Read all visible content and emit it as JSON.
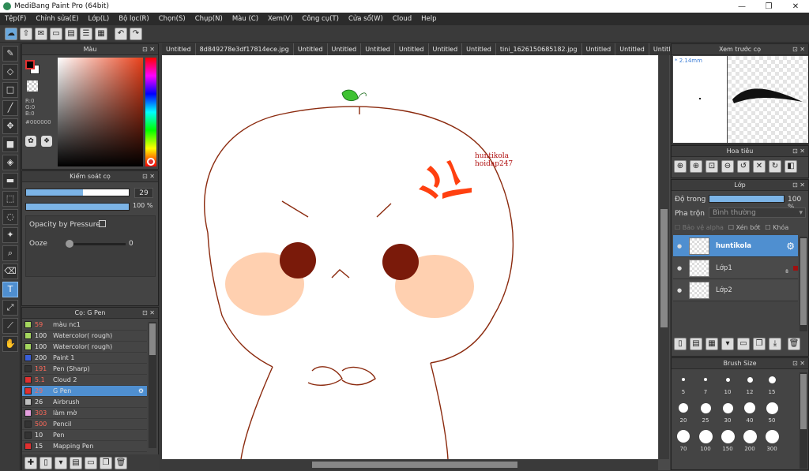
{
  "window": {
    "title": "MediBang Paint Pro (64bit)"
  },
  "menu": [
    "Tệp(F)",
    "Chỉnh sửa(E)",
    "Lớp(L)",
    "Bộ lọc(R)",
    "Chọn(S)",
    "Chụp(N)",
    "Màu (C)",
    "Xem(V)",
    "Công cụ(T)",
    "Cửa sổ(W)",
    "Cloud",
    "Help"
  ],
  "tabs": [
    "Untitled",
    "8d849278e3df17814ece.jpg",
    "Untitled",
    "Untitled",
    "Untitled",
    "Untitled",
    "Untitled",
    "Untitled",
    "tini_1626150685182.jpg",
    "Untitled",
    "Untitled",
    "Untitled",
    "Untitled"
  ],
  "color_panel": {
    "title": "Màu",
    "r": "R:0",
    "g": "G:0",
    "b": "B:0",
    "hex": "#000000"
  },
  "brush_control": {
    "title": "Kiểm soát cọ",
    "size": "29",
    "opacity": "100 %",
    "opacity_pressure": "Opacity by Pressure",
    "ooze": "Ooze",
    "ooze_value": "0"
  },
  "brush_panel": {
    "title": "Cọ: G Pen",
    "items": [
      {
        "size": "59",
        "name": "màu nc1",
        "color": "#a4d65e",
        "sel": false,
        "red": true
      },
      {
        "size": "100",
        "name": "Watercolor( rough)",
        "color": "#a4d65e",
        "sel": false,
        "red": false
      },
      {
        "size": "100",
        "name": "Watercolor( rough)",
        "color": "#a4d65e",
        "sel": false,
        "red": false
      },
      {
        "size": "200",
        "name": "Paint 1",
        "color": "#3a5fd9",
        "sel": false,
        "red": false
      },
      {
        "size": "191",
        "name": "Pen (Sharp)",
        "color": "#333333",
        "sel": false,
        "red": true
      },
      {
        "size": "5.1",
        "name": "Cloud 2",
        "color": "#e03030",
        "sel": false,
        "red": true
      },
      {
        "size": "29",
        "name": "G Pen",
        "color": "#e03030",
        "sel": true,
        "red": true
      },
      {
        "size": "26",
        "name": "Airbrush",
        "color": "#c0c0c0",
        "sel": false,
        "red": false
      },
      {
        "size": "303",
        "name": "làm mờ",
        "color": "#e6a0e0",
        "sel": false,
        "red": true
      },
      {
        "size": "500",
        "name": "Pencil",
        "color": "#333333",
        "sel": false,
        "red": true
      },
      {
        "size": "10",
        "name": "Pen",
        "color": "#333333",
        "sel": false,
        "red": false
      },
      {
        "size": "15",
        "name": "Mapping Pen",
        "color": "#e03030",
        "sel": false,
        "red": false
      }
    ]
  },
  "preview": {
    "title": "Xem trước cọ",
    "size": "* 2.14mm"
  },
  "navigator": {
    "title": "Hoa tiêu"
  },
  "layers": {
    "title": "Lớp",
    "opacity_label": "Độ trong",
    "opacity": "100 %",
    "blend_label": "Pha trộn",
    "blend": "Bình thường",
    "protect_alpha": "Bảo vệ alpha",
    "clipping": "Xén bớt",
    "lock": "Khóa",
    "items": [
      {
        "name": "huntikola",
        "sel": true
      },
      {
        "name": "Lớp1",
        "sel": false,
        "badge": "8"
      },
      {
        "name": "Lớp2",
        "sel": false
      }
    ]
  },
  "brush_size": {
    "title": "Brush Size",
    "sizes": [
      "5",
      "7",
      "10",
      "12",
      "15",
      "20",
      "25",
      "30",
      "40",
      "50",
      "70",
      "100",
      "150",
      "200",
      "300"
    ]
  },
  "canvas": {
    "watermark1": "huntikola",
    "watermark2": "hoidap247"
  },
  "colors": {
    "accent": "#4f8fd0",
    "stroke": "#8b2a0e",
    "cheek": "#ffd0b0",
    "eye": "#7a1a0a",
    "anger": "#ff4010",
    "leaf": "#3ec232"
  }
}
